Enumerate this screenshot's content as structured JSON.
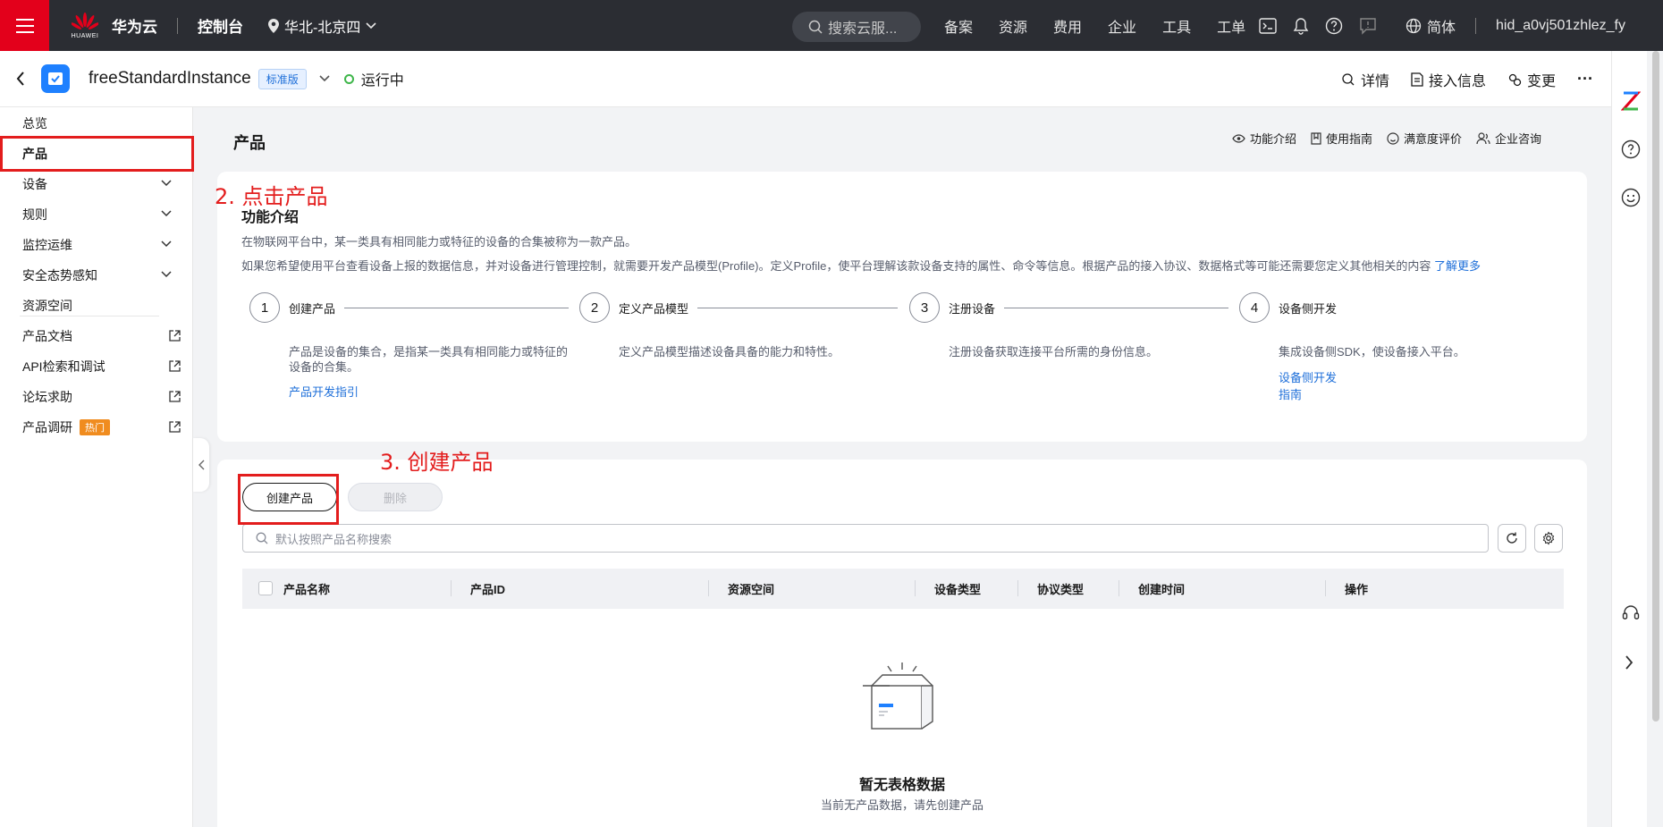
{
  "topbar": {
    "brand": "华为云",
    "logo_text": "HUAWEI",
    "console": "控制台",
    "region": "华北-北京四",
    "search_placeholder": "搜索云服...",
    "nav": [
      "备案",
      "资源",
      "费用",
      "企业",
      "工具",
      "工单"
    ],
    "language": "简体",
    "username": "hid_a0vj501zhlez_fy"
  },
  "instance": {
    "name": "freeStandardInstance",
    "edition_badge": "标准版",
    "status": "运行中",
    "status_color": "#3fb64b",
    "actions": [
      "详情",
      "接入信息",
      "变更"
    ],
    "more": "···"
  },
  "sidebar": {
    "items": [
      {
        "label": "总览"
      },
      {
        "label": "产品"
      },
      {
        "label": "设备"
      },
      {
        "label": "规则"
      },
      {
        "label": "监控运维"
      },
      {
        "label": "安全态势感知"
      },
      {
        "label": "资源空间"
      },
      {
        "label": "产品文档"
      },
      {
        "label": "API检索和调试"
      },
      {
        "label": "论坛求助"
      },
      {
        "label": "产品调研",
        "badge": "热门"
      }
    ]
  },
  "page": {
    "title": "产品",
    "links": [
      "功能介绍",
      "使用指南",
      "满意度评价",
      "企业咨询"
    ]
  },
  "intro": {
    "title": "功能介绍",
    "line1": "在物联网平台中，某一类具有相同能力或特征的设备的合集被称为一款产品。",
    "line2": "如果您希望使用平台查看设备上报的数据信息，并对设备进行管理控制，就需要开发产品模型(Profile)。定义Profile，使平台理解该款设备支持的属性、命令等信息。根据产品的接入协议、数据格式等可能还需要您定义其他相关的内容",
    "learn_more": "了解更多",
    "steps": [
      {
        "num": "1",
        "title": "创建产品",
        "desc": "产品是设备的集合，是指某一类具有相同能力或特征的设备的合集。",
        "link": "产品开发指引"
      },
      {
        "num": "2",
        "title": "定义产品模型",
        "desc": "定义产品模型描述设备具备的能力和特性。",
        "link": ""
      },
      {
        "num": "3",
        "title": "注册设备",
        "desc": "注册设备获取连接平台所需的身份信息。",
        "link": ""
      },
      {
        "num": "4",
        "title": "设备侧开发",
        "desc": "集成设备侧SDK，使设备接入平台。",
        "link": "设备侧开发指南"
      }
    ]
  },
  "toolbar": {
    "create_label": "创建产品",
    "delete_label": "删除",
    "search_placeholder": "默认按照产品名称搜索"
  },
  "table": {
    "columns": [
      "产品名称",
      "产品ID",
      "资源空间",
      "设备类型",
      "协议类型",
      "创建时间",
      "操作"
    ],
    "rows": [],
    "empty_title": "暂无表格数据",
    "empty_subtitle": "当前无产品数据，请先创建产品"
  },
  "annotations": {
    "step2": "2. 点击产品",
    "step3": "3. 创建产品",
    "color": "#e31d1d"
  }
}
